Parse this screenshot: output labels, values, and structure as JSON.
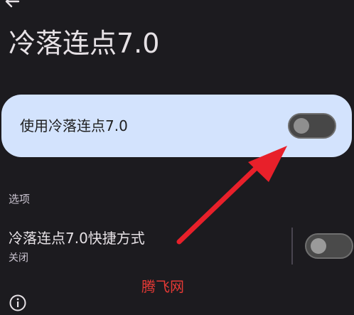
{
  "header": {
    "back_icon": "arrow-left-icon",
    "title": "冷落连点7.0"
  },
  "main_card": {
    "label": "使用冷落连点7.0",
    "switch_on": false
  },
  "options": {
    "section_label": "选项",
    "shortcut": {
      "title": "冷落连点7.0快捷方式",
      "status": "关闭",
      "switch_on": false
    }
  },
  "footer": {
    "info_icon": "info-icon"
  },
  "overlay": {
    "watermark": "腾飞网",
    "annotation_icon": "red-arrow-icon",
    "annotation_color": "#e8202a"
  },
  "colors": {
    "background": "#1c1b1f",
    "card": "#d3e3fd",
    "text": "#e6e1e5"
  }
}
